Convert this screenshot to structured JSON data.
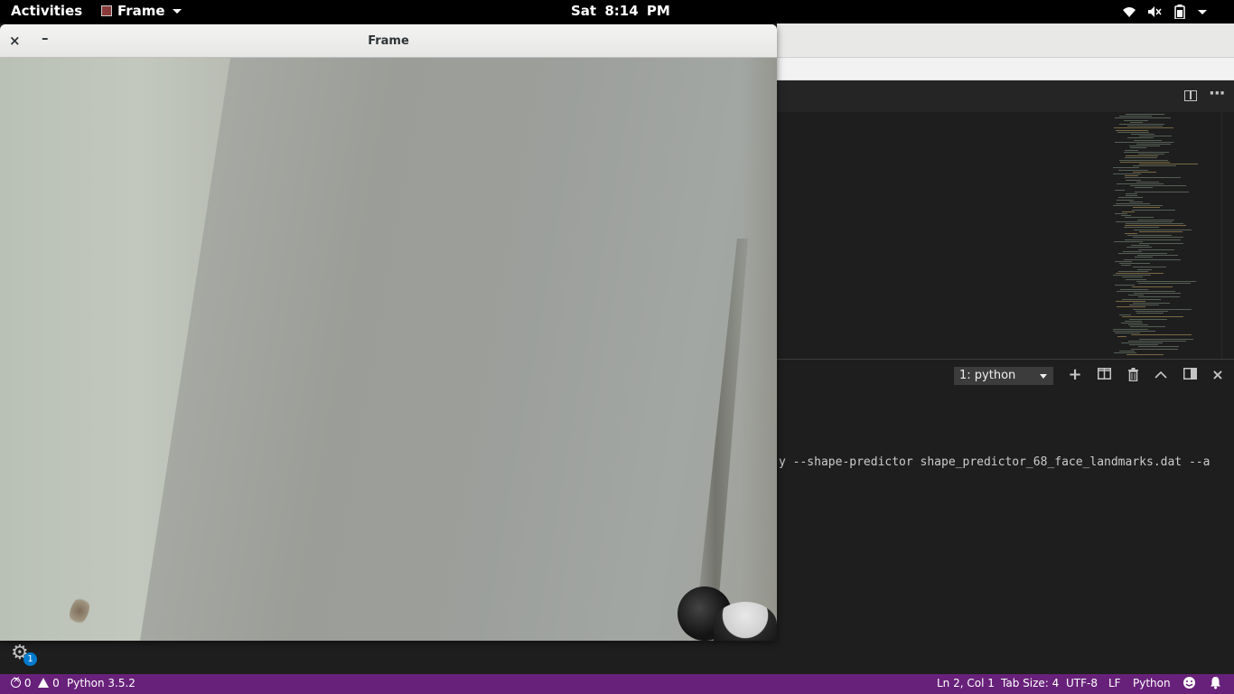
{
  "topbar": {
    "activities": "Activities",
    "app_name": "Frame",
    "clock": "Sat  8:14 PM"
  },
  "frame_window": {
    "title": "Frame",
    "close_glyph": "×",
    "minimize_glyph": "–"
  },
  "terminal": {
    "selected_terminal": "1: python",
    "visible_command_fragment": "y --shape-predictor shape_predictor_68_face_landmarks.dat --a"
  },
  "panel_buttons": {
    "new_terminal": "+",
    "maximize": "^",
    "close": "×"
  },
  "notifications": {
    "badge_count": "1"
  },
  "statusbar": {
    "errors": "0",
    "warnings": "0",
    "interpreter": "Python 3.5.2",
    "position": "Ln 2, Col 1",
    "tab_size": "Tab Size: 4",
    "encoding": "UTF-8",
    "line_ending": "LF",
    "language": "Python",
    "accent_color": "#68217a"
  },
  "icons": [
    "wifi-icon",
    "volume-muted-icon",
    "battery-icon",
    "split-editor-icon",
    "more-actions-icon",
    "trash-icon",
    "toggle-panel-icon",
    "gear-icon",
    "smiley-icon",
    "bell-icon"
  ]
}
